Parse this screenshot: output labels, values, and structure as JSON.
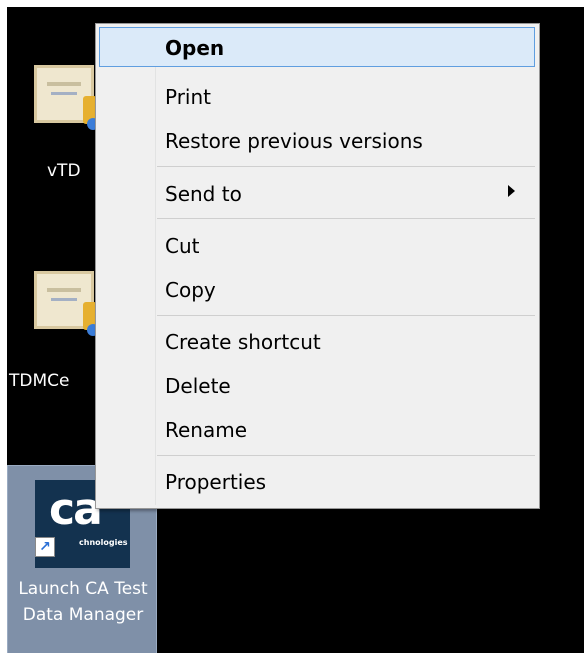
{
  "desktop": {
    "icons": [
      {
        "label": "vTD",
        "icon": "certificate-document-icon"
      },
      {
        "label": "TDMCe",
        "icon": "certificate-document-icon"
      }
    ],
    "selected_shortcut": {
      "label": "Launch CA Test Data Manager",
      "logo_text": "ca",
      "logo_sub": "chnologies",
      "icon": "shortcut-arrow-icon"
    }
  },
  "context_menu": {
    "items": [
      {
        "label": "Open"
      },
      {
        "label": "Print"
      },
      {
        "label": "Restore previous versions"
      },
      {
        "label": "Send to"
      },
      {
        "label": "Cut"
      },
      {
        "label": "Copy"
      },
      {
        "label": "Create shortcut"
      },
      {
        "label": "Delete"
      },
      {
        "label": "Rename"
      },
      {
        "label": "Properties"
      }
    ]
  },
  "colors": {
    "desktop_background": "#000000",
    "menu_background": "#f0f0f0",
    "highlight_fill": "#dbeaf9",
    "highlight_border": "#5f9ee0",
    "selection_fill": "#7f90a8",
    "ca_logo_background": "#13324f"
  }
}
